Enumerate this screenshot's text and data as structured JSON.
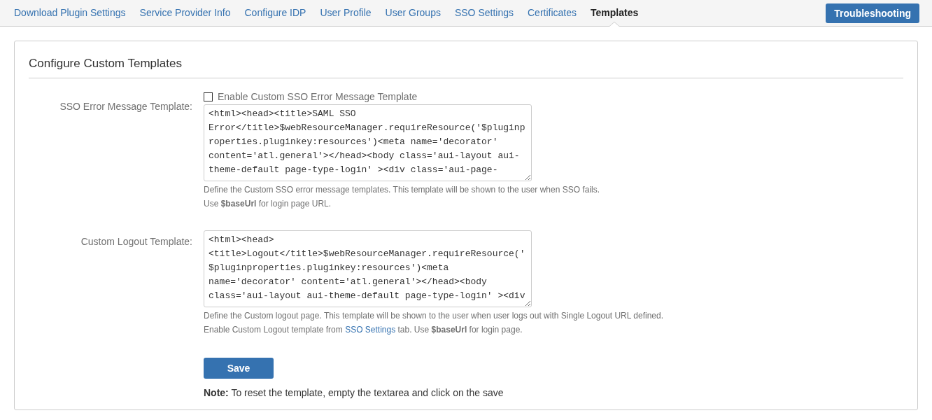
{
  "tabs": [
    {
      "label": "Download Plugin Settings",
      "selected": false
    },
    {
      "label": "Service Provider Info",
      "selected": false
    },
    {
      "label": "Configure IDP",
      "selected": false
    },
    {
      "label": "User Profile",
      "selected": false
    },
    {
      "label": "User Groups",
      "selected": false
    },
    {
      "label": "SSO Settings",
      "selected": false
    },
    {
      "label": "Certificates",
      "selected": false
    },
    {
      "label": "Templates",
      "selected": true
    }
  ],
  "troubleshooting_button": "Troubleshooting",
  "panel": {
    "title": "Configure Custom Templates",
    "fields": [
      {
        "label": "SSO Error Message Template:",
        "checkbox": {
          "label": "Enable Custom SSO Error Message Template",
          "checked": false
        },
        "value": "<html><head><title>SAML SSO Error</title>$webResourceManager.requireResource('$pluginproperties.pluginkey:resources')<meta name='decorator' content='atl.general'></head><body class='aui-layout aui-theme-default page-type-login' ><div class='aui-page-",
        "help": [
          "Define the Custom SSO error message templates. This template will be shown to the user when SSO fails.",
          "Use **$baseUrl** for login page URL."
        ]
      },
      {
        "label": "Custom Logout Template:",
        "value": "<html><head> <title>Logout</title>$webResourceManager.requireResource(' $pluginproperties.pluginkey:resources')<meta name='decorator' content='atl.general'></head><body class='aui-layout aui-theme-default page-type-login' ><div",
        "help": [
          "Define the Custom logout page. This template will be shown to the user when user logs out with Single Logout URL defined.",
          {
            "before": "Enable Custom Logout template from",
            "link": "SSO Settings",
            "after": "tab. Use **$baseUrl** for login page."
          }
        ]
      }
    ],
    "save_button": "Save",
    "note": "**Note:** To reset the template, empty the textarea and click on the save"
  }
}
